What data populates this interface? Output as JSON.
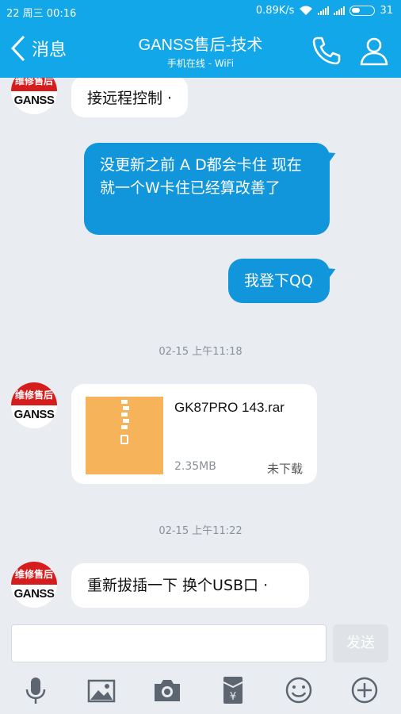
{
  "status": {
    "time": "22 周三  00:16",
    "speed": "0.89K/s",
    "battery": "31"
  },
  "header": {
    "back_label": "消息",
    "title": "GANSS售后-技术",
    "subtitle": "手机在线 - WiFi"
  },
  "avatar": {
    "top_text": "维修售后",
    "bottom_text": "GANSS"
  },
  "messages": [
    {
      "side": "in",
      "text": "接远程控制 ·"
    },
    {
      "side": "out",
      "text": "没更新之前 A D都会卡住 现在就一个W卡住已经算改善了"
    },
    {
      "side": "out",
      "text": "我登下QQ"
    },
    {
      "side": "in",
      "text": "重新拔插一下 换个USB口 ·"
    }
  ],
  "timestamps": [
    "02-15 上午11:18",
    "02-15 上午11:22"
  ],
  "file": {
    "name": "GK87PRO 143.rar",
    "size": "2.35MB",
    "status": "未下载"
  },
  "input": {
    "placeholder": ""
  },
  "send_label": "发送",
  "toolbar": [
    "mic-icon",
    "image-icon",
    "camera-icon",
    "red-packet-icon",
    "emoji-icon",
    "plus-icon"
  ],
  "colors": {
    "header": "#12a7e8",
    "out_bubble": "#1296db",
    "background": "#e9edf1",
    "file_icon": "#f6b35a"
  }
}
